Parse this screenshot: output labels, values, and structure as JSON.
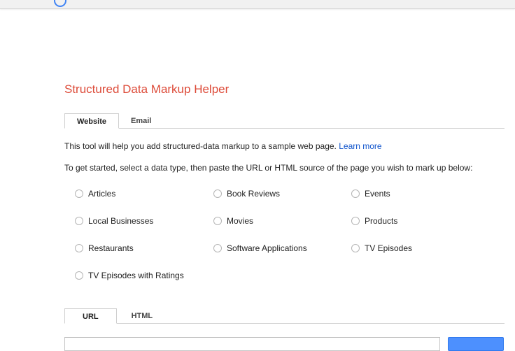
{
  "header": {
    "title": "Structured Data Markup Helper",
    "logo_icon": "google-logo-fragment"
  },
  "source_tabs": [
    {
      "label": "Website",
      "active": true
    },
    {
      "label": "Email",
      "active": false
    }
  ],
  "description": {
    "text": "This tool will help you add structured-data markup to a sample web page.",
    "link": "Learn more"
  },
  "instruction": "To get started, select a data type, then paste the URL or HTML source of the page you wish to mark up below:",
  "data_types": [
    {
      "label": "Articles"
    },
    {
      "label": "Book Reviews"
    },
    {
      "label": "Events"
    },
    {
      "label": "Local Businesses"
    },
    {
      "label": "Movies"
    },
    {
      "label": "Products"
    },
    {
      "label": "Restaurants"
    },
    {
      "label": "Software Applications"
    },
    {
      "label": "TV Episodes"
    },
    {
      "label": "TV Episodes with Ratings"
    }
  ],
  "input_tabs": [
    {
      "label": "URL",
      "active": true
    },
    {
      "label": "HTML",
      "active": false
    }
  ],
  "colors": {
    "title": "#dd4b39",
    "link": "#1155cc",
    "button": "#4d90fe"
  }
}
